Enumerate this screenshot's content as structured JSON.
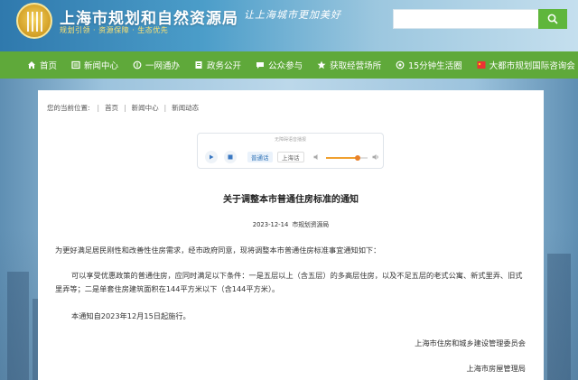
{
  "header": {
    "site_title": "上海市规划和自然资源局",
    "site_subtitle": "规划引领 · 资源保障 · 生态优先",
    "slogan": "让上海城市更加美好",
    "search_placeholder": ""
  },
  "nav": {
    "items": [
      {
        "label": "首页",
        "icon": "home-icon"
      },
      {
        "label": "新闻中心",
        "icon": "news-icon"
      },
      {
        "label": "一网通办",
        "icon": "service-icon"
      },
      {
        "label": "政务公开",
        "icon": "document-icon"
      },
      {
        "label": "公众参与",
        "icon": "chat-icon"
      },
      {
        "label": "获取经营场所",
        "icon": "star-icon"
      },
      {
        "label": "15分钟生活圈",
        "icon": "circle-icon"
      },
      {
        "label": "大都市规划国际咨询会",
        "icon": "flag-icon"
      }
    ]
  },
  "breadcrumb": {
    "prefix": "您的当前位置:",
    "items": [
      "首页",
      "新闻中心",
      "新闻动态"
    ]
  },
  "player": {
    "title": "无障碍语音播报",
    "mode_active": "普通话",
    "mode_other": "上海话",
    "volume": 0.75
  },
  "article": {
    "title": "关于调整本市普通住房标准的通知",
    "date": "2023-12-14",
    "source": "市规划资源局",
    "paragraphs": [
      "为更好满足居民刚性和改善性住房需求，经市政府同意，现将调整本市普通住房标准事宜通知如下：",
      "可以享受优惠政策的普通住房，应同时满足以下条件：一是五层以上（含五层）的多高层住房，以及不足五层的老式公寓、新式里弄、旧式里弄等；二是单套住房建筑面积在144平方米以下（含144平方米）。",
      "本通知自2023年12月15日起施行。"
    ],
    "signatures": [
      "上海市住房和城乡建设管理委员会",
      "上海市房屋管理局"
    ]
  },
  "colors": {
    "nav_green": "#5fa93a",
    "search_button": "#5fb63c",
    "header_blue": "#2f79ad"
  }
}
